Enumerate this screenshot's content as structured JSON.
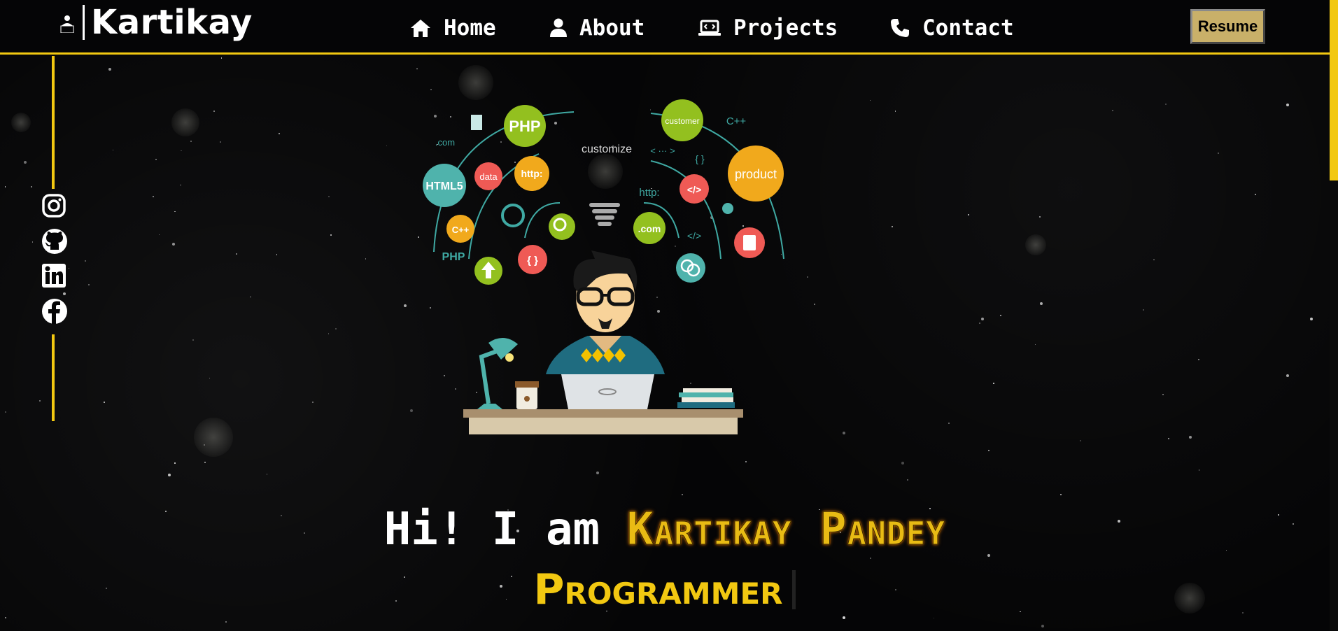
{
  "brand": {
    "name": "Kartikay",
    "icon": "user-laptop-icon"
  },
  "nav": [
    {
      "label": "Home",
      "icon": "home-icon"
    },
    {
      "label": "About",
      "icon": "user-icon"
    },
    {
      "label": "Projects",
      "icon": "laptop-code-icon"
    },
    {
      "label": "Contact",
      "icon": "phone-icon"
    }
  ],
  "resume_label": "Resume",
  "social": [
    {
      "name": "instagram",
      "icon": "instagram-icon"
    },
    {
      "name": "github",
      "icon": "github-icon"
    },
    {
      "name": "linkedin",
      "icon": "linkedin-icon"
    },
    {
      "name": "facebook",
      "icon": "facebook-icon"
    }
  ],
  "hero": {
    "bubbles": [
      "PHP",
      "customer",
      "C++",
      "HTML5",
      "data",
      "http:",
      "product",
      "C++",
      "PHP",
      ".com",
      "{ }",
      "</>",
      "http:",
      ".com",
      "customize",
      "< ··· >",
      "{ }",
      "</>"
    ]
  },
  "greeting": {
    "prefix": "Hi! I am",
    "name": "Kartikay Pandey",
    "role": "Programmer"
  },
  "colors": {
    "accent": "#f2c811",
    "background": "#050506",
    "resume_bg": "#c9b069"
  }
}
